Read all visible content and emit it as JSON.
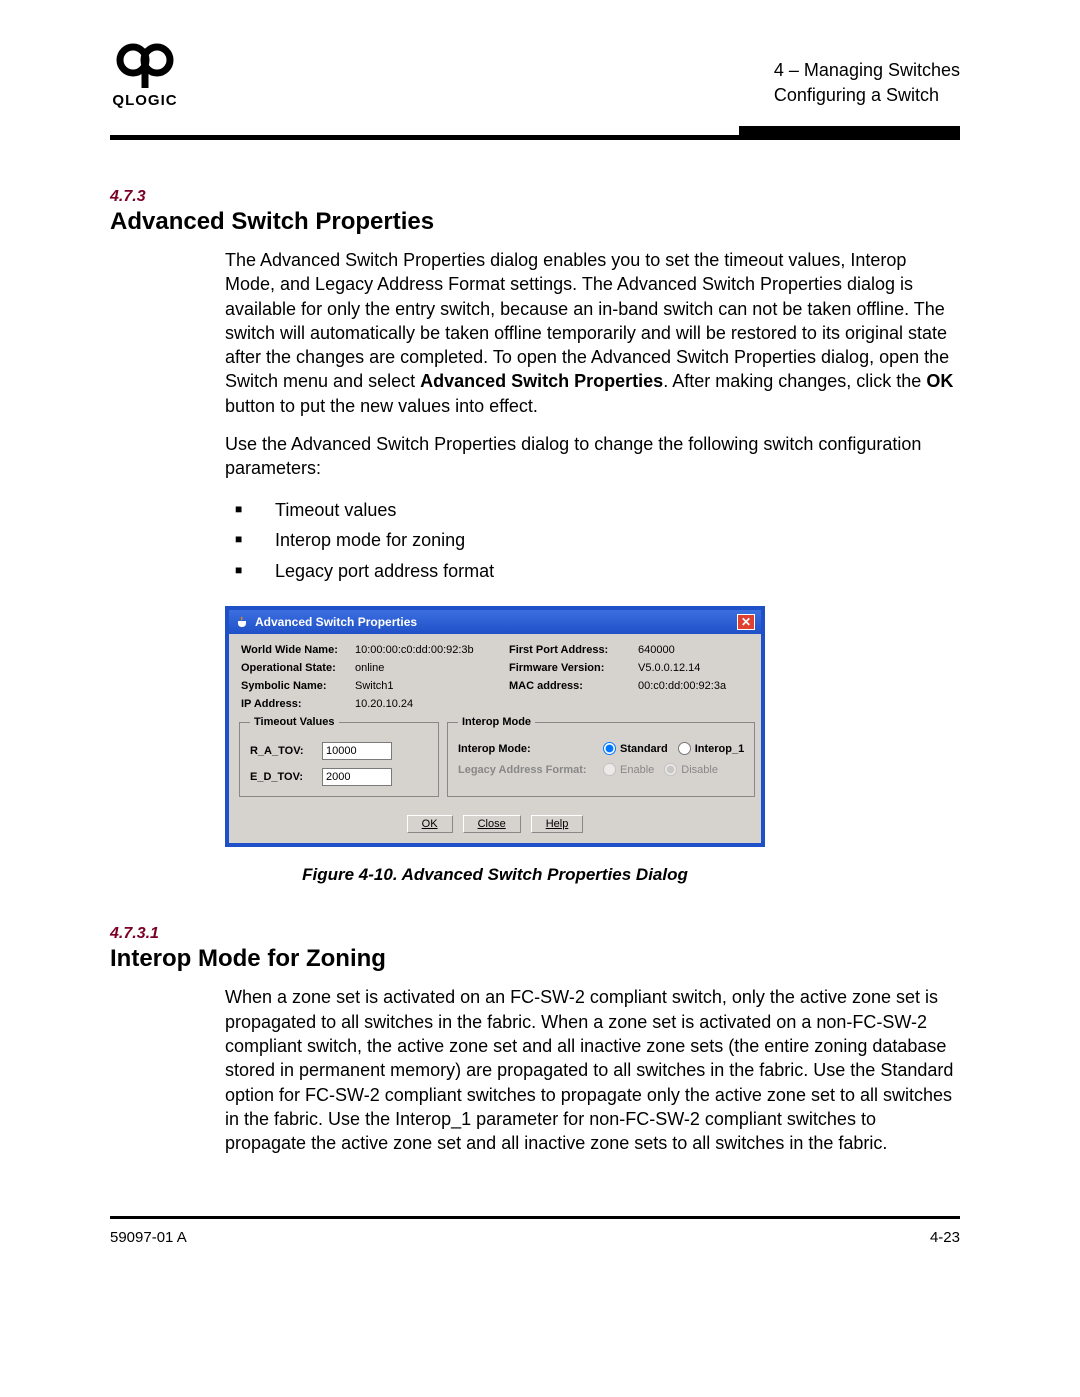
{
  "header": {
    "chapter_ref": "4 – Managing Switches",
    "section_ref": "Configuring a Switch"
  },
  "sec1": {
    "num": "4.7.3",
    "title": "Advanced Switch Properties",
    "para1_a": "The Advanced Switch Properties dialog enables you to set the timeout values, Interop Mode, and Legacy Address Format settings. The Advanced Switch Properties dialog is available for only the entry switch, because an in-band switch can not be taken offline. The switch will automatically be taken offline temporarily and will be restored to its original state after the changes are completed. To open the Advanced Switch Properties dialog, open the Switch menu and select ",
    "para1_b1": "Advanced Switch Properties",
    "para1_c": ". After making changes, click the ",
    "para1_b2": "OK",
    "para1_d": " button to put the new values into effect.",
    "para2": "Use the Advanced Switch Properties dialog to change the following switch configuration parameters:",
    "bullets": [
      "Timeout values",
      "Interop mode for zoning",
      "Legacy port address format"
    ]
  },
  "dialog": {
    "title": "Advanced Switch Properties",
    "info": {
      "wwn_label": "World Wide Name:",
      "wwn_value": "10:00:00:c0:dd:00:92:3b",
      "fpa_label": "First Port Address:",
      "fpa_value": "640000",
      "opstate_label": "Operational State:",
      "opstate_value": "online",
      "fw_label": "Firmware Version:",
      "fw_value": "V5.0.0.12.14",
      "sym_label": "Symbolic Name:",
      "sym_value": "Switch1",
      "mac_label": "MAC address:",
      "mac_value": "00:c0:dd:00:92:3a",
      "ip_label": "IP Address:",
      "ip_value": "10.20.10.24"
    },
    "timeout_legend": "Timeout Values",
    "ratov_label": "R_A_TOV:",
    "ratov_value": "10000",
    "edtov_label": "E_D_TOV:",
    "edtov_value": "2000",
    "interop_legend": "Interop Mode",
    "interop_mode_label": "Interop Mode:",
    "interop_standard": "Standard",
    "interop_1": "Interop_1",
    "legacy_label": "Legacy Address Format:",
    "legacy_enable": "Enable",
    "legacy_disable": "Disable",
    "btn_ok": "OK",
    "btn_close": "Close",
    "btn_help": "Help"
  },
  "figure_caption": "Figure 4-10.  Advanced Switch Properties Dialog",
  "sec2": {
    "num": "4.7.3.1",
    "title": "Interop Mode for Zoning",
    "para": "When a zone set is activated on an FC-SW-2 compliant switch, only the active zone set is propagated to all switches in the fabric. When a zone set is activated on a non-FC-SW-2 compliant switch, the active zone set and all inactive zone sets (the entire zoning database stored in permanent memory) are propagated to all switches in the fabric. Use the Standard option for FC-SW-2 compliant switches to propagate only the active zone set to all switches in the fabric. Use the Interop_1 parameter for non-FC-SW-2 compliant switches to propagate the active zone set and all inactive zone sets to all switches in the fabric."
  },
  "footer": {
    "left": "59097-01 A",
    "right": "4-23"
  }
}
